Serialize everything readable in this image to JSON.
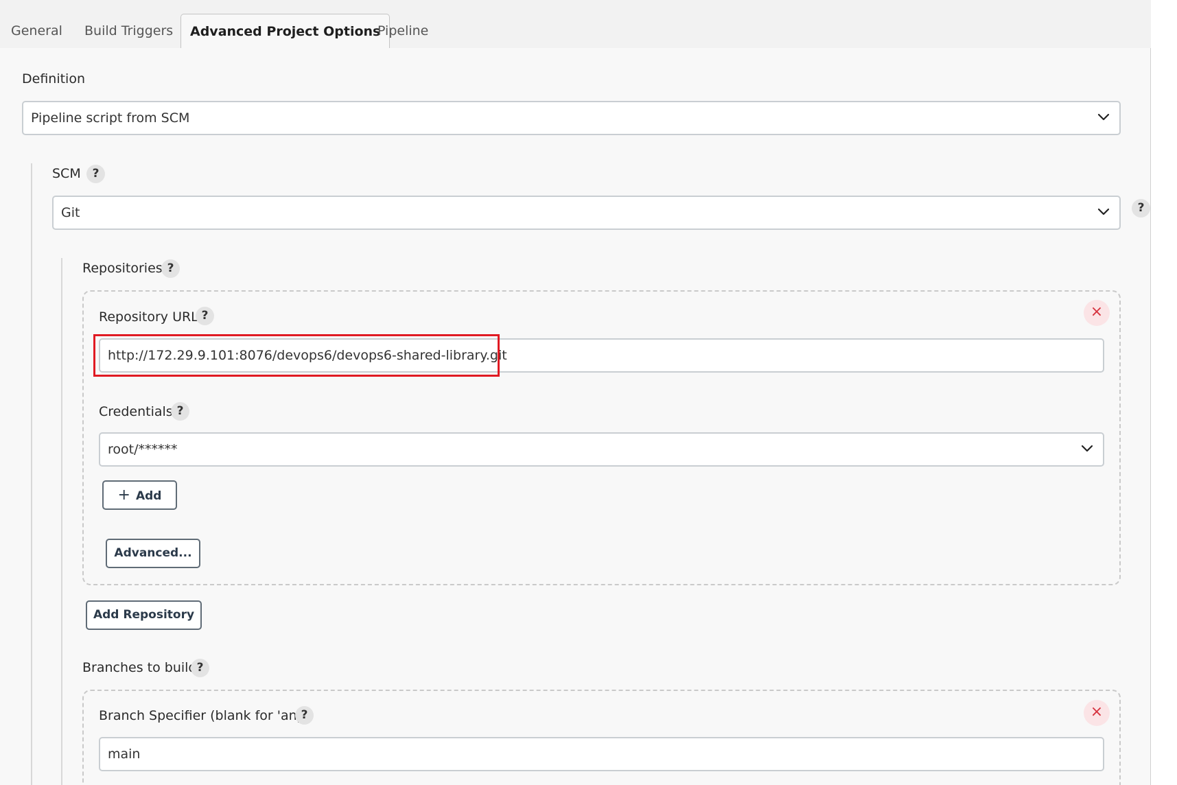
{
  "tabs": [
    {
      "label": "General"
    },
    {
      "label": "Build Triggers"
    },
    {
      "label": "Advanced Project Options"
    },
    {
      "label": "Pipeline"
    }
  ],
  "definition": {
    "label": "Definition",
    "value": "Pipeline script from SCM"
  },
  "scm": {
    "label": "SCM",
    "help": "?",
    "value": "Git"
  },
  "repositories": {
    "label": "Repositories",
    "help": "?",
    "url_label": "Repository URL",
    "url_value": "http://172.29.9.101:8076/devops6/devops6-shared-library.git",
    "credentials_label": "Credentials",
    "credentials_value": "root/******",
    "add_label": "Add",
    "advanced_label": "Advanced...",
    "add_repository_label": "Add Repository",
    "remove_icon": "×"
  },
  "branches": {
    "label": "Branches to build",
    "help": "?",
    "specifier_label": "Branch Specifier (blank for 'any')",
    "specifier_value": "main",
    "remove_icon": "×"
  },
  "colors": {
    "highlight": "#e01a23",
    "remove": "#d6323e",
    "button_border": "#5f6b76"
  }
}
